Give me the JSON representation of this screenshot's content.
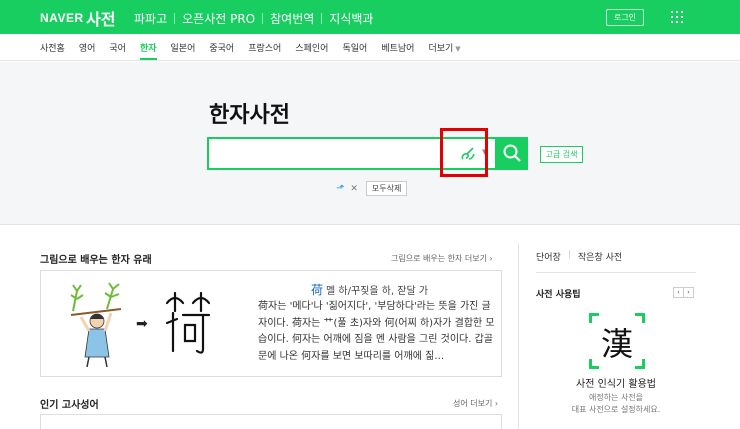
{
  "colors": {
    "brand_green": "#19ce60",
    "highlight_red": "#e40000",
    "link_blue": "#1a63c8"
  },
  "header": {
    "logo": "NAVER",
    "service": "사전",
    "nav": [
      "파파고",
      "오픈사전 PRO",
      "참여번역",
      "지식백과"
    ],
    "login": "로그인",
    "apps_icon": "grid-icon"
  },
  "subnav": {
    "tabs": [
      "사전홈",
      "영어",
      "국어",
      "한자",
      "일본어",
      "중국어",
      "프랑스어",
      "스페인어",
      "독일어",
      "베트남어",
      "더보기"
    ],
    "active": "한자"
  },
  "search": {
    "title": "한자사전",
    "query": "",
    "handwriting_icon": "brush-icon",
    "search_icon": "search-icon",
    "advanced": "고급 검색",
    "history_clear": "모두삭제"
  },
  "origin": {
    "title": "그림으로 배우는 한자 유래",
    "more": "그림으로 배우는 한자 더보기",
    "hanja": "荷",
    "meaning": "멜 하/꾸짖을 하, 잗달 가",
    "description": "荷자는 '메다'나 '짊어지다', '부담하다'라는 뜻을 가진 글자이다. 荷자는 艹(풀 초)자와 何(어찌 하)자가 결합한 모습이다. 何자는 어깨에 짐을 멘 사람을 그린 것이다. 갑골문에 나온 何자를 보면 보따리를 어깨에 짊…"
  },
  "idioms": {
    "title": "인기 고사성어",
    "more": "성어 더보기"
  },
  "right": {
    "tabs": [
      "단어장",
      "작은창 사전"
    ],
    "tips_title": "사전 사용팁",
    "pager_prev": "‹",
    "pager_next": "›",
    "tip_icon_char": "漢",
    "tip_name": "사전 인식기 활용법",
    "tip_desc_1": "애정하는 사전을",
    "tip_desc_2": "대표 사전으로 설정하세요."
  }
}
